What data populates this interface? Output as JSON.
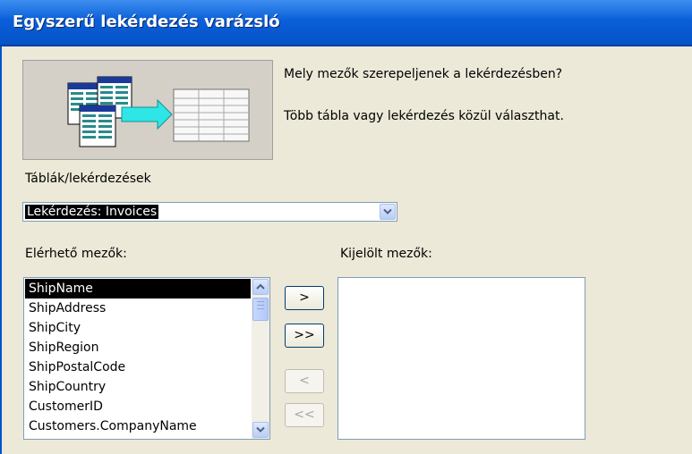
{
  "window": {
    "title": "Egyszerű lekérdezés varázsló"
  },
  "intro": {
    "question": "Mely mezők szerepeljenek a lekérdezésben?",
    "hint": "Több tábla vagy lekérdezés közül választhat."
  },
  "source": {
    "label": "Táblák/lekérdezések",
    "selected": "Lekérdezés: Invoices"
  },
  "available": {
    "label": "Elérhető mezők:",
    "items": [
      "ShipName",
      "ShipAddress",
      "ShipCity",
      "ShipRegion",
      "ShipPostalCode",
      "ShipCountry",
      "CustomerID",
      "Customers.CompanyName"
    ],
    "selected_index": 0
  },
  "selected_fields": {
    "label": "Kijelölt mezők:",
    "items": []
  },
  "buttons": {
    "add_one": ">",
    "add_all": ">>",
    "remove_one": "<",
    "remove_all": "<<"
  },
  "icons": {
    "combo_arrow": "chevron-down-icon",
    "scroll_up": "chevron-up-icon",
    "scroll_down": "chevron-down-icon",
    "illustration": "query-wizard-illustration"
  },
  "colors": {
    "title_bar": "#0553c7",
    "client_bg": "#ece9d8",
    "selection": "#000000"
  }
}
